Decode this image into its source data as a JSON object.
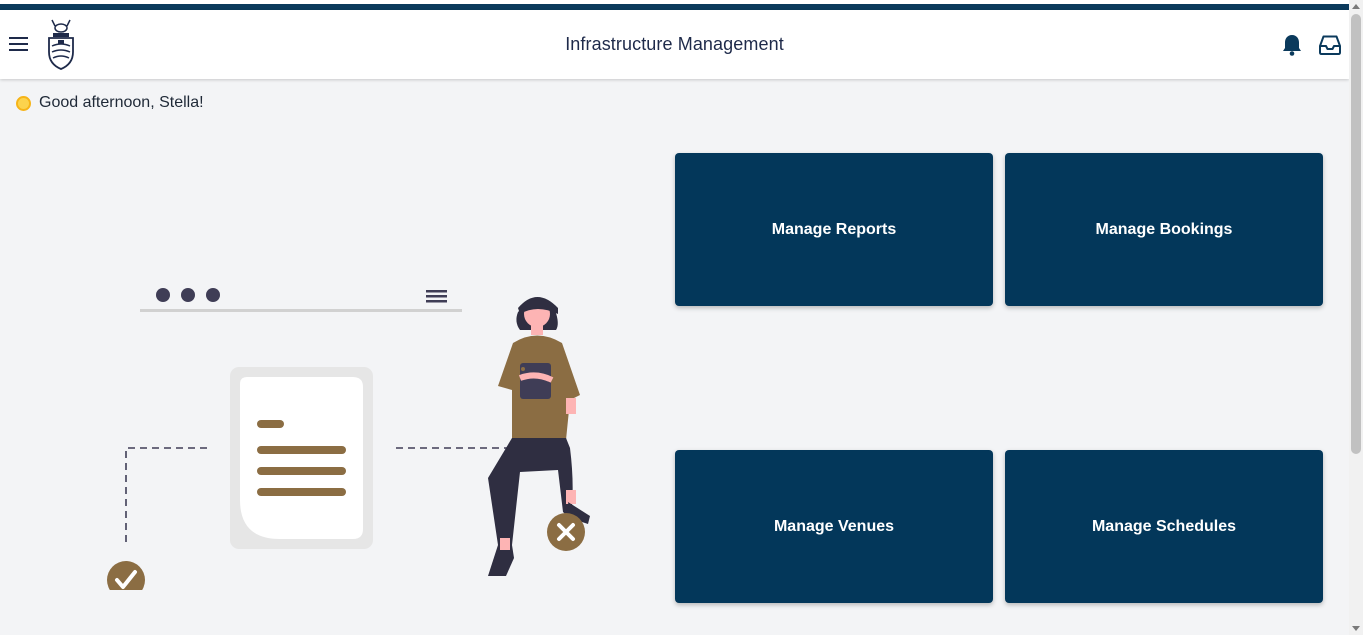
{
  "header": {
    "title": "Infrastructure Management",
    "menu_icon": "hamburger-menu-icon",
    "logo_icon": "university-crest-logo",
    "notifications_icon": "bell-icon",
    "inbox_icon": "inbox-tray-icon"
  },
  "greeting": {
    "icon": "sun-icon",
    "text": "Good afternoon, Stella!"
  },
  "tiles": [
    {
      "label": "Manage Reports"
    },
    {
      "label": "Manage Bookings"
    },
    {
      "label": "Manage Venues"
    },
    {
      "label": "Manage Schedules"
    }
  ],
  "colors": {
    "brand_navy": "#03375a",
    "accent_brown": "#8b6d43",
    "background": "#f3f4f6"
  }
}
